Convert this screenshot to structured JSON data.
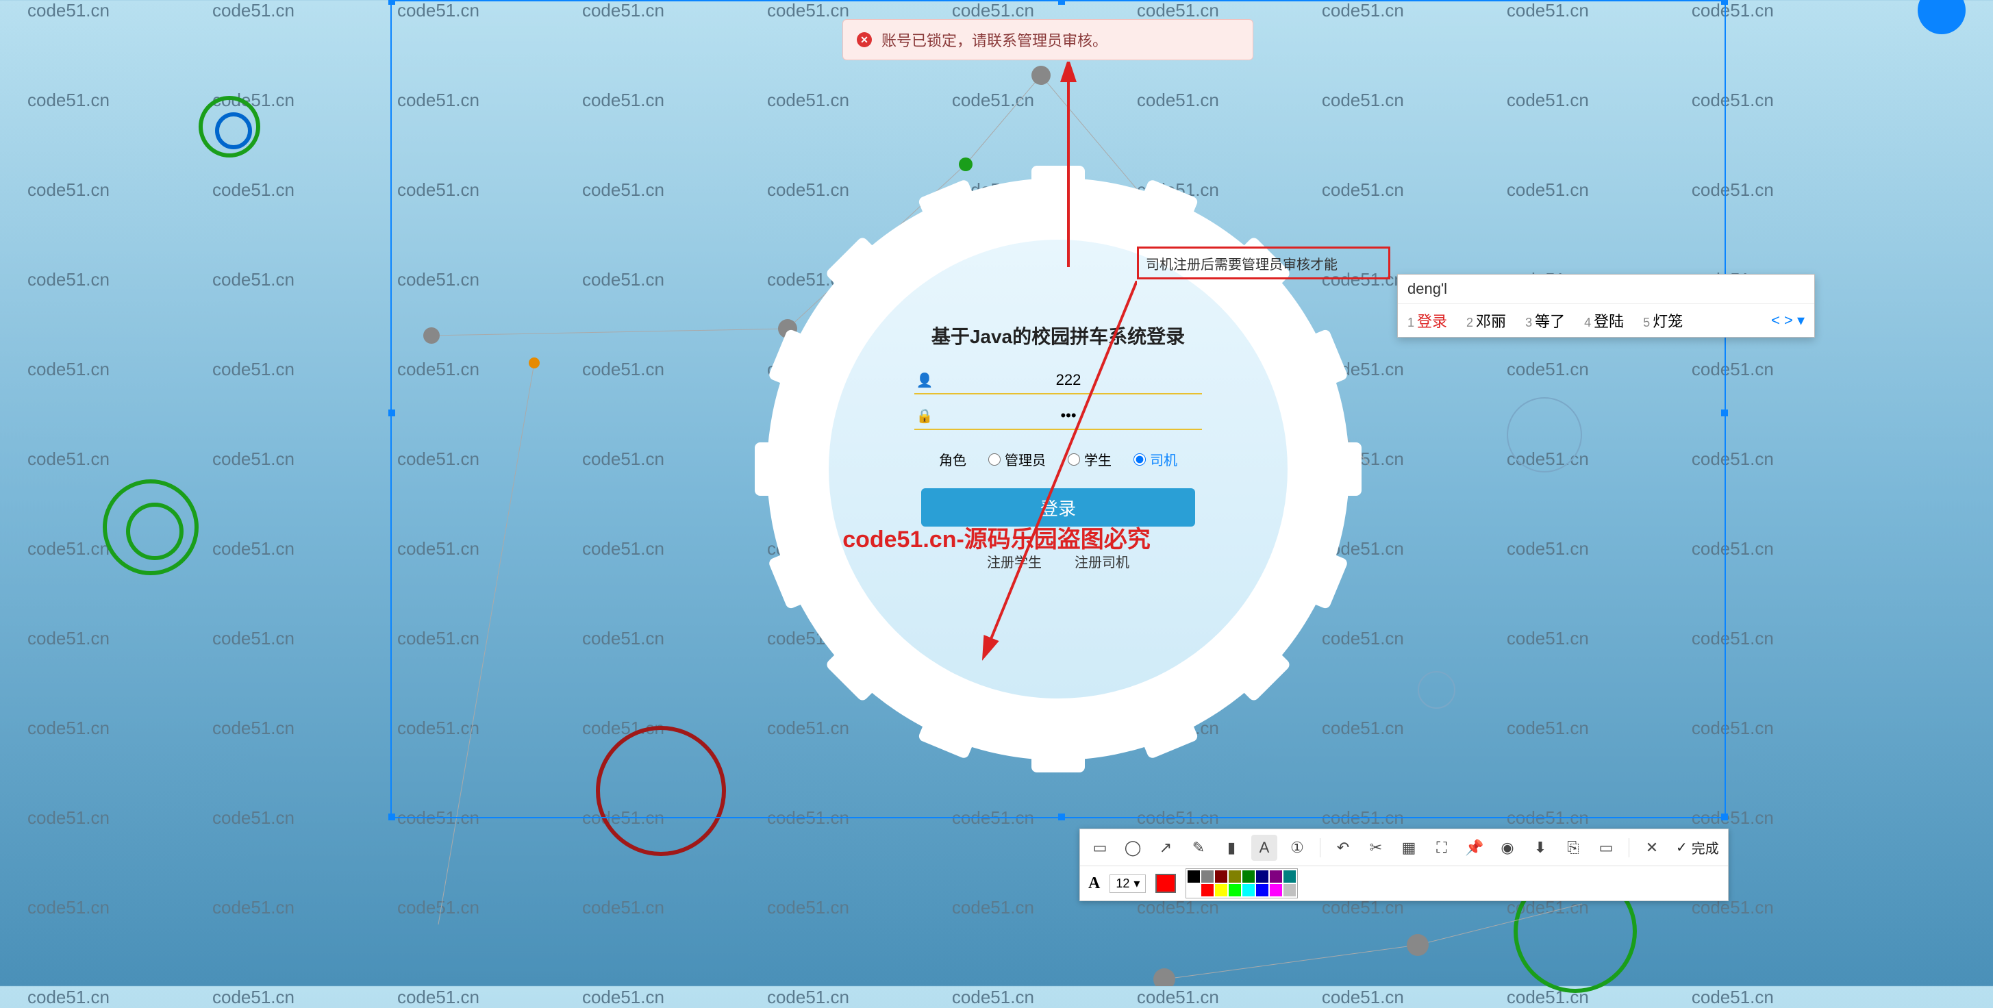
{
  "watermark_text": "code51.cn",
  "center_watermark": "code51.cn-源码乐园盗图必究",
  "error_banner": {
    "text": "账号已锁定，请联系管理员审核。"
  },
  "annotation": {
    "text": "司机注册后需要管理员审核才能"
  },
  "login": {
    "title": "基于Java的校园拼车系统登录",
    "username_value": "222",
    "password_value": "•••",
    "role_label": "角色",
    "role_admin": "管理员",
    "role_student": "学生",
    "role_driver": "司机",
    "role_selected": "driver",
    "submit_label": "登录",
    "register_student": "注册学生",
    "register_driver": "注册司机"
  },
  "ime": {
    "input": "deng'l",
    "candidates": [
      {
        "num": "1",
        "text": "登录"
      },
      {
        "num": "2",
        "text": "邓丽"
      },
      {
        "num": "3",
        "text": "等了"
      },
      {
        "num": "4",
        "text": "登陆"
      },
      {
        "num": "5",
        "text": "灯笼"
      }
    ]
  },
  "toolbar": {
    "font_size": "12",
    "done_label": "完成",
    "current_color": "#ff0000",
    "palette": [
      "#000000",
      "#808080",
      "#800000",
      "#808000",
      "#008000",
      "#000080",
      "#800080",
      "#008080",
      "#ffffff",
      "#ff0000",
      "#ffff00",
      "#00ff00",
      "#00ffff",
      "#0000ff",
      "#ff00ff",
      "#c0c0c0"
    ]
  }
}
